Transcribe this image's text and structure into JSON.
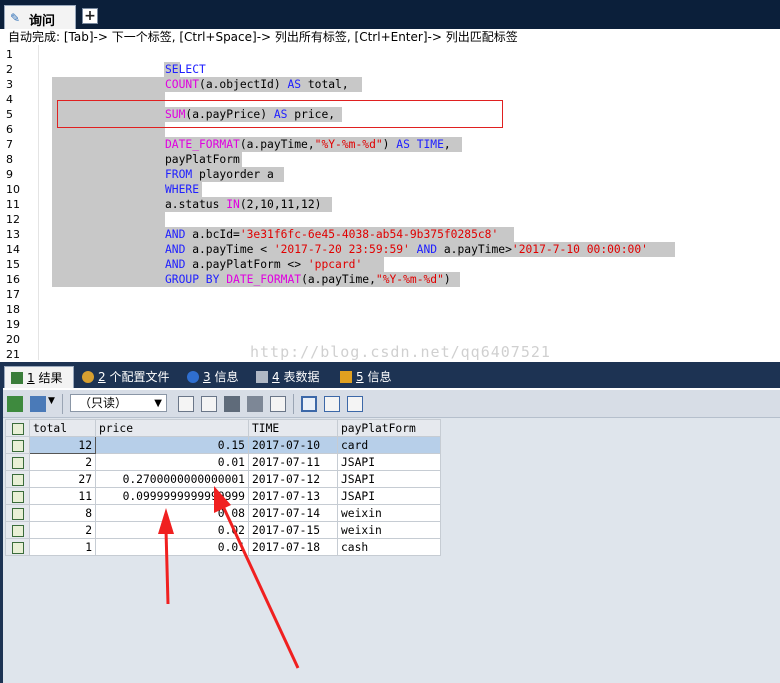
{
  "window": {
    "tab_label": "询问",
    "new_tab_symbol": "+",
    "hint": "自动完成: [Tab]-> 下一个标签, [Ctrl+Space]-> 列出所有标签, [Ctrl+Enter]-> 列出匹配标签"
  },
  "editor": {
    "line_numbers": [
      "1",
      "2",
      "3",
      "4",
      "5",
      "6",
      "7",
      "8",
      "9",
      "10",
      "11",
      "12",
      "13",
      "14",
      "15",
      "16",
      "17",
      "18",
      "19",
      "20",
      "21"
    ],
    "watermark": "http://blog.csdn.net/qq6407521"
  },
  "result_tabs": [
    {
      "num": "1",
      "label": "结果"
    },
    {
      "num": "2",
      "label": "个配置文件"
    },
    {
      "num": "3",
      "label": "信息"
    },
    {
      "num": "4",
      "label": "表数据"
    },
    {
      "num": "5",
      "label": "信息"
    }
  ],
  "toolbar": {
    "mode_select": "（只读）"
  },
  "grid": {
    "columns": [
      "total",
      "price",
      "TIME",
      "payPlatForm"
    ],
    "rows": [
      {
        "total": "12",
        "price": "0.15",
        "time": "2017-07-10",
        "platform": "card"
      },
      {
        "total": "2",
        "price": "0.01",
        "time": "2017-07-11",
        "platform": "JSAPI"
      },
      {
        "total": "27",
        "price": "0.2700000000000001",
        "time": "2017-07-12",
        "platform": "JSAPI"
      },
      {
        "total": "11",
        "price": "0.0999999999999999",
        "time": "2017-07-13",
        "platform": "JSAPI"
      },
      {
        "total": "8",
        "price": "0.08",
        "time": "2017-07-14",
        "platform": "weixin"
      },
      {
        "total": "2",
        "price": "0.02",
        "time": "2017-07-15",
        "platform": "weixin"
      },
      {
        "total": "1",
        "price": "0.01",
        "time": "2017-07-18",
        "platform": "cash"
      }
    ]
  },
  "sql": {
    "l2": "SELECT",
    "l3_fn": "COUNT",
    "l3_a": "(a.objectId) ",
    "l3_kw": "AS",
    "l3_b": " total,",
    "l5_fn": "SUM",
    "l5_a": "(a.payPrice) ",
    "l5_kw": "AS",
    "l5_b": " price,",
    "l7_fn": "DATE_FORMAT",
    "l7_a": "(a.payTime,",
    "l7_s": "\"%Y-%m-%d\"",
    "l7_b": ") ",
    "l7_kw": "AS",
    "l7_c": " ",
    "l7_kw2": "TIME",
    "l7_d": ",",
    "l8": "payPlatForm",
    "l9_kw": "FROM",
    "l9_b": " playorder a",
    "l10": "WHERE",
    "l11_a": "a.status ",
    "l11_kw": "IN",
    "l11_b": "(2,10,11,12)",
    "l13_kw": "AND",
    "l13_a": " a.bcId=",
    "l13_s": "'3e31f6fc-6e45-4038-ab54-9b375f0285c8'",
    "l14_kw": "AND",
    "l14_a": " a.payTime < ",
    "l14_s": "'2017-7-20 23:59:59'",
    "l14_b": " ",
    "l14_kw2": "AND",
    "l14_c": " a.payTime>",
    "l14_s2": "'2017-7-10 00:00:00'",
    "l15_kw": "AND",
    "l15_a": " a.payPlatForm <> ",
    "l15_s": "'ppcard'",
    "l16_kw": "GROUP BY",
    "l16_a": " ",
    "l16_fn": "DATE_FORMAT",
    "l16_b": "(a.payTime,",
    "l16_s": "\"%Y-%m-%d\"",
    "l16_c": ")"
  },
  "colors": {
    "keyword": "#2020ff",
    "function": "#e000e0",
    "string": "#e00000",
    "highlight_box": "#e02020",
    "annotation_arrow": "#f02020"
  }
}
